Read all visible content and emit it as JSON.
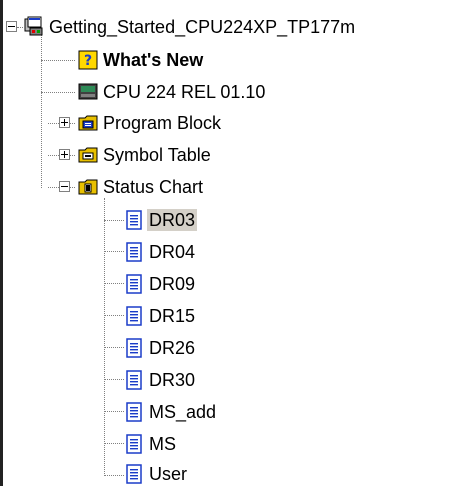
{
  "tree": {
    "root": {
      "label": "Getting_Started_CPU224XP_TP177m",
      "expanded": true,
      "icon": "project-icon"
    },
    "children": [
      {
        "label": "What's New",
        "icon": "help-icon",
        "bold": true
      },
      {
        "label": "CPU 224 REL 01.10",
        "icon": "cpu-icon"
      },
      {
        "label": "Program Block",
        "icon": "program-block-icon",
        "expanded": false
      },
      {
        "label": "Symbol Table",
        "icon": "symbol-table-icon",
        "expanded": false
      },
      {
        "label": "Status Chart",
        "icon": "folder-icon",
        "expanded": true,
        "items": [
          {
            "label": "DR03",
            "selected": true
          },
          {
            "label": "DR04"
          },
          {
            "label": "DR09"
          },
          {
            "label": "DR15"
          },
          {
            "label": "DR26"
          },
          {
            "label": "DR30"
          },
          {
            "label": "MS_add"
          },
          {
            "label": "MS"
          },
          {
            "label": "User"
          }
        ]
      }
    ]
  },
  "colors": {
    "selection": "#d4d0c8",
    "lines": "#808080",
    "folder": "#e8c000",
    "doc": "#1a3cc8"
  }
}
